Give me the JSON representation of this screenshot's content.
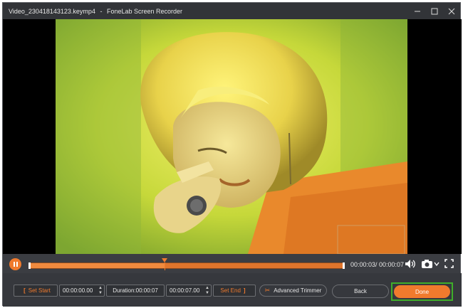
{
  "window": {
    "file_name": "Video_230418143123.keymp4",
    "separator": "-",
    "app_name": "FoneLab Screen Recorder",
    "minimize_icon": "minimize-icon",
    "maximize_icon": "maximize-icon",
    "close_icon": "close-icon"
  },
  "player": {
    "pause_icon": "pause-icon",
    "progress": 0.43,
    "time_readout": "00:00:03/ 00:00:07",
    "volume_icon": "speaker-icon",
    "camera_icon": "camera-icon",
    "fullscreen_icon": "fullscreen-icon"
  },
  "trim": {
    "set_start_label": "Set Start",
    "start_time": "00:00:00.00",
    "duration_label": "Duration:00:00:07",
    "end_time": "00:00:07.00",
    "set_end_label": "Set End",
    "advanced_trimmer_label": "Advanced Trimmer"
  },
  "actions": {
    "back_label": "Back",
    "done_label": "Done"
  },
  "colors": {
    "accent": "#f07a2d",
    "highlight_border": "#3fae2a",
    "background": "#3b3d42"
  }
}
